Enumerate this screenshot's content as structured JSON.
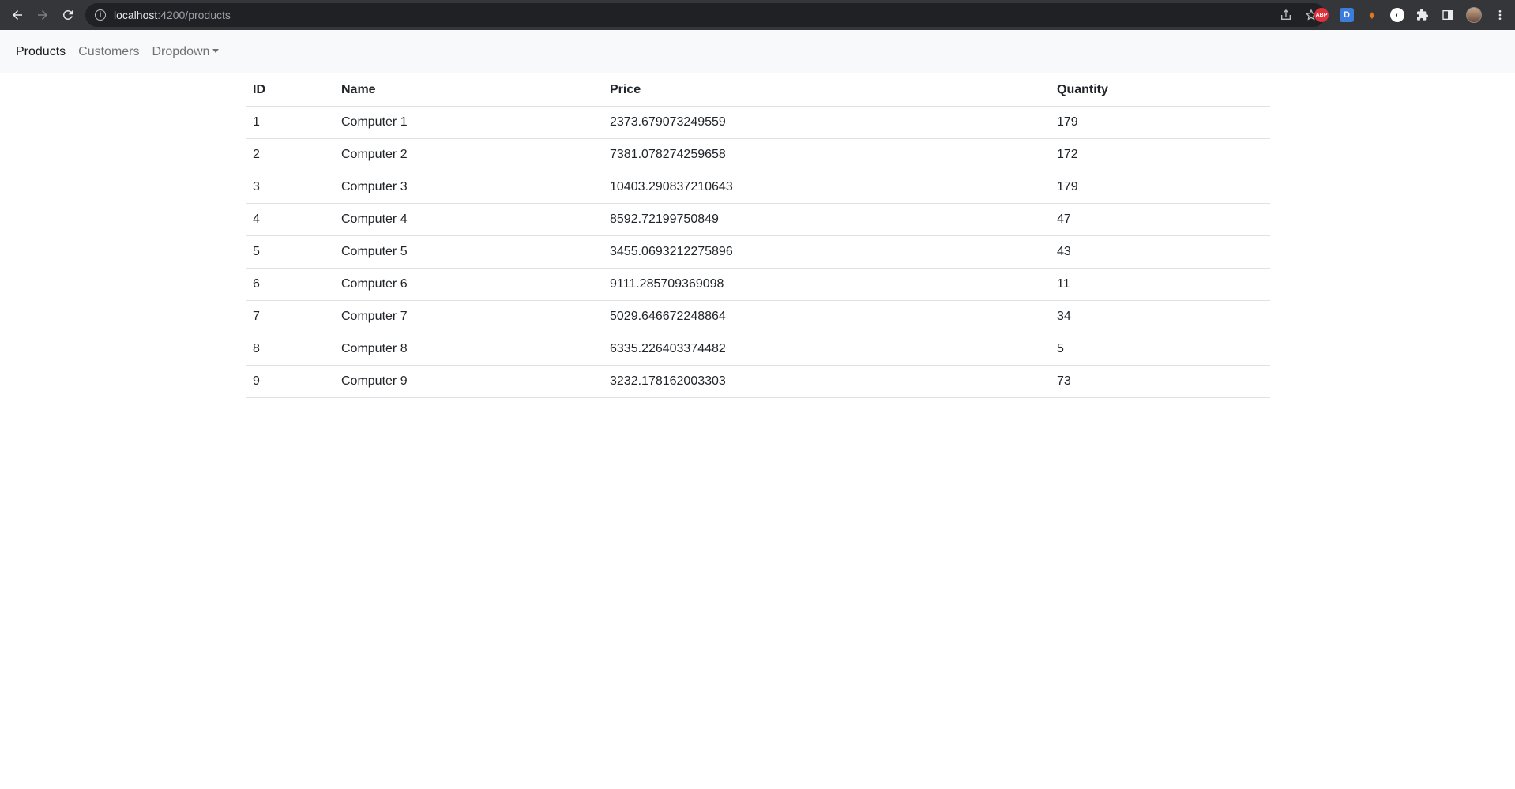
{
  "browser": {
    "url_host": "localhost",
    "url_path": ":4200/products"
  },
  "navbar": {
    "links": [
      {
        "label": "Products",
        "active": true
      },
      {
        "label": "Customers",
        "active": false
      },
      {
        "label": "Dropdown",
        "active": false
      }
    ]
  },
  "table": {
    "headers": [
      "ID",
      "Name",
      "Price",
      "Quantity"
    ],
    "rows": [
      [
        "1",
        "Computer 1",
        "2373.679073249559",
        "179"
      ],
      [
        "2",
        "Computer 2",
        "7381.078274259658",
        "172"
      ],
      [
        "3",
        "Computer 3",
        "10403.290837210643",
        "179"
      ],
      [
        "4",
        "Computer 4",
        "8592.72199750849",
        "47"
      ],
      [
        "5",
        "Computer 5",
        "3455.0693212275896",
        "43"
      ],
      [
        "6",
        "Computer 6",
        "9111.285709369098",
        "11"
      ],
      [
        "7",
        "Computer 7",
        "5029.646672248864",
        "34"
      ],
      [
        "8",
        "Computer 8",
        "6335.226403374482",
        "5"
      ],
      [
        "9",
        "Computer 9",
        "3232.178162003303",
        "73"
      ]
    ]
  }
}
